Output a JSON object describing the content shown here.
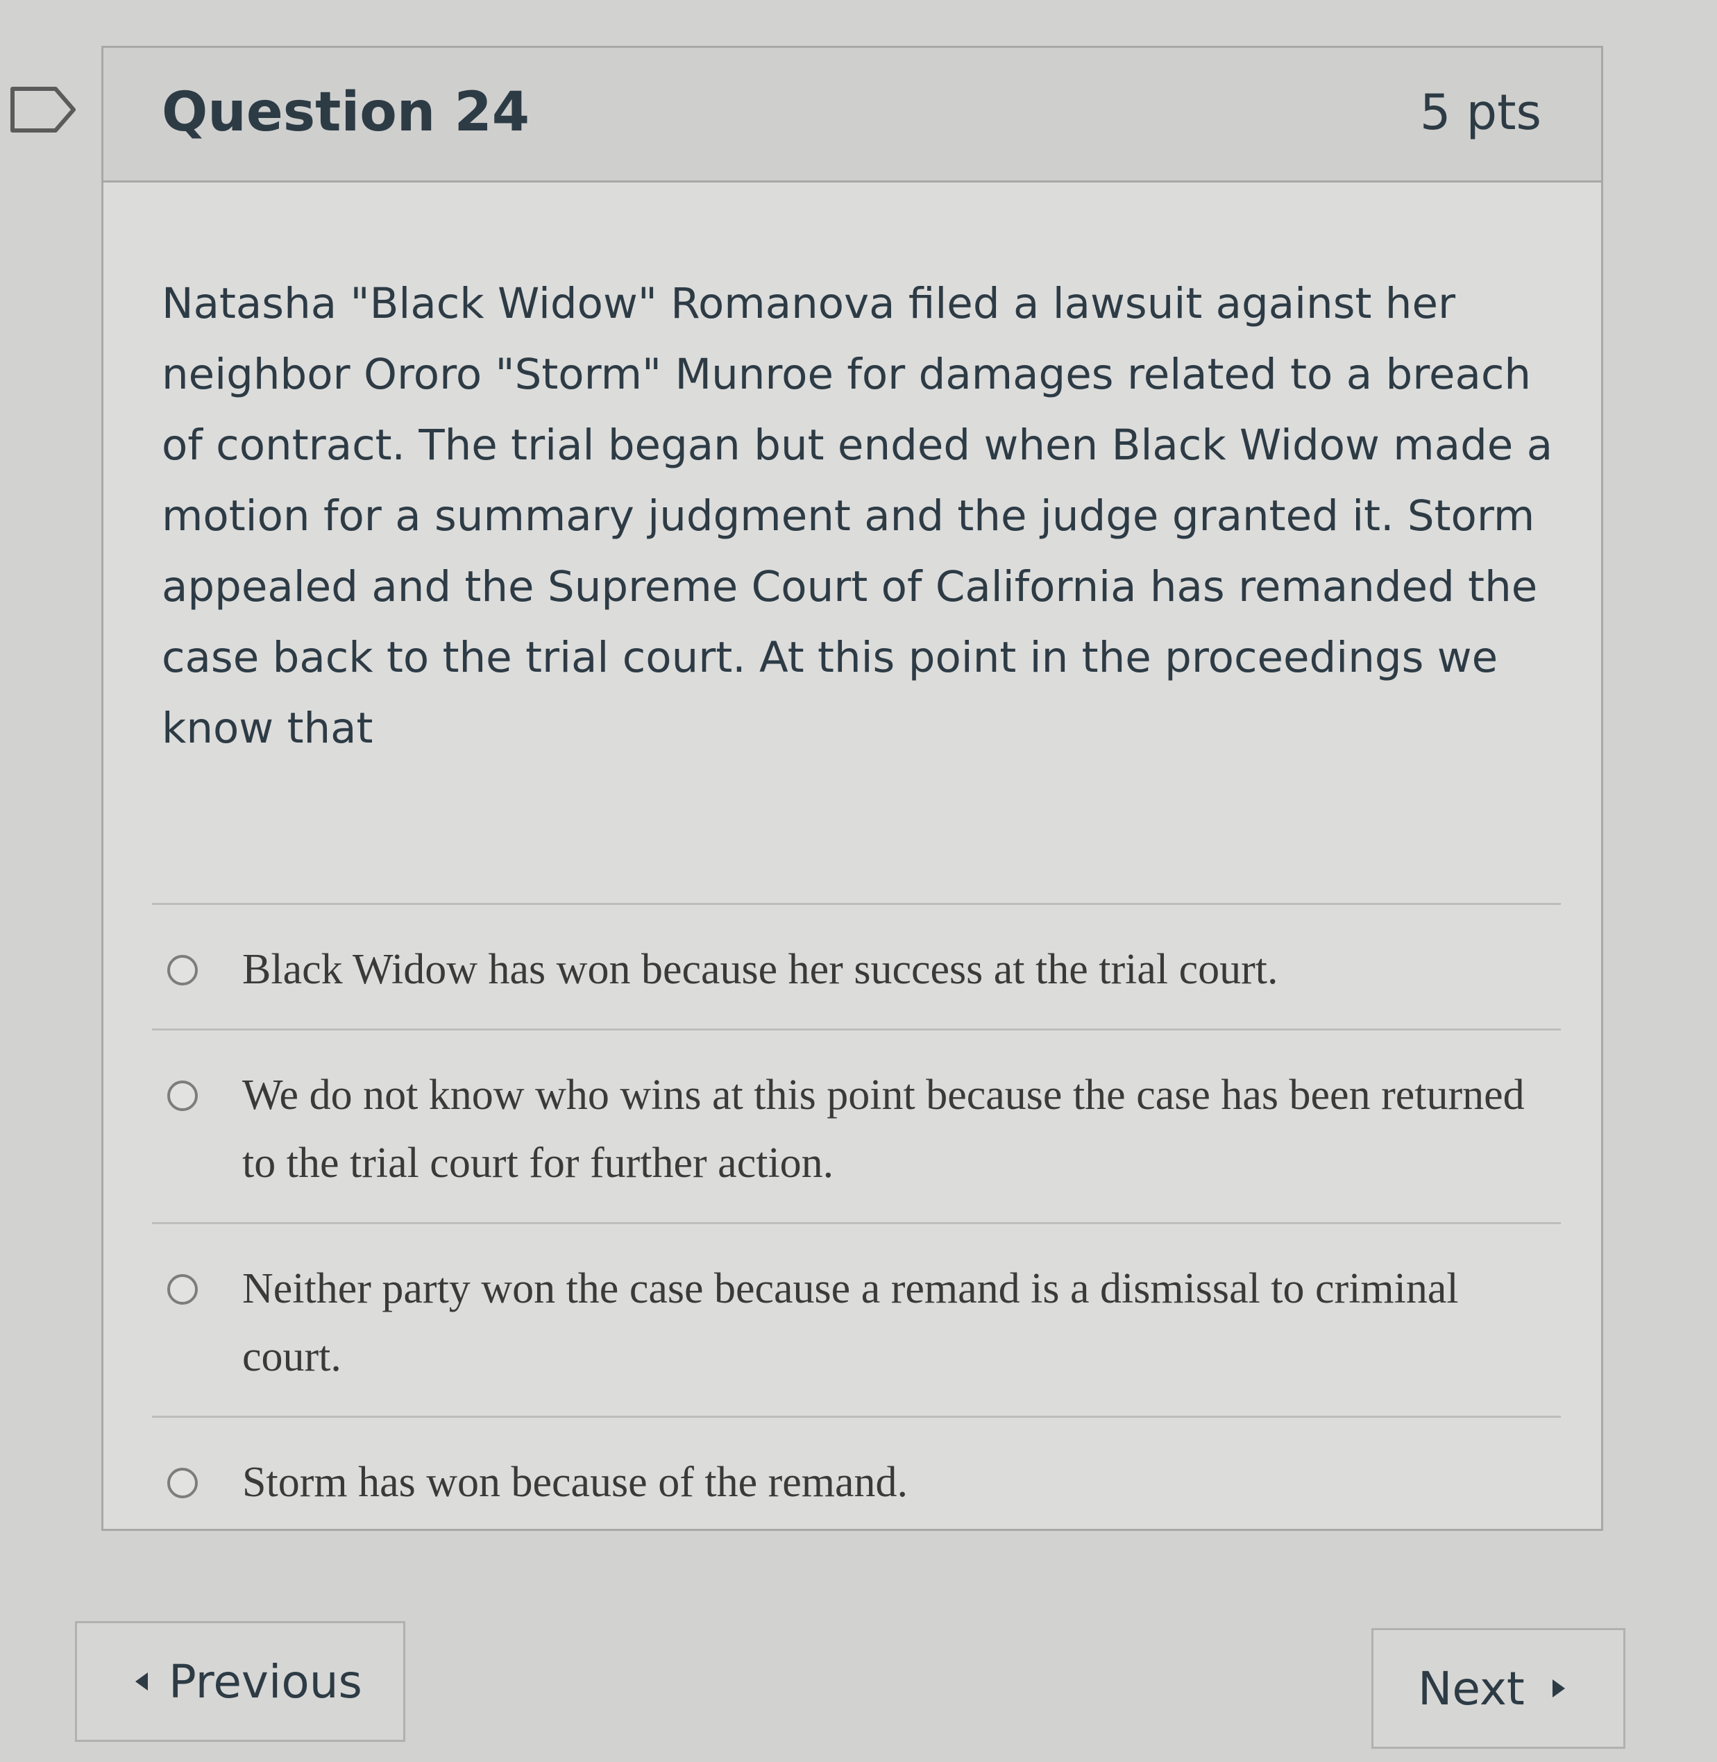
{
  "question": {
    "title": "Question 24",
    "points": "5 pts",
    "text": "Natasha \"Black Widow\" Romanova filed a lawsuit against her neighbor Ororo \"Storm\" Munroe for damages related to a breach of contract. The trial began but ended when Black Widow made a motion for a summary judgment and the judge granted it. Storm appealed and the Supreme Court of California has remanded the case back to the trial court. At this point in the proceedings we know that",
    "flag_icon": "flag-outline-icon"
  },
  "answers": [
    {
      "label": "Black Widow has won because her success at the trial court.",
      "selected": false
    },
    {
      "label": "We do not know who wins at this point because the case has been returned to the trial court for further action.",
      "selected": false
    },
    {
      "label": "Neither party won the case because a remand is a dismissal to criminal court.",
      "selected": false
    },
    {
      "label": "Storm has won because of the remand.",
      "selected": false
    }
  ],
  "navigation": {
    "previous_label": "Previous",
    "next_label": "Next"
  },
  "colors": {
    "text": "#2d3b45",
    "background": "#d2d2d1",
    "border": "#a8a8a8"
  }
}
